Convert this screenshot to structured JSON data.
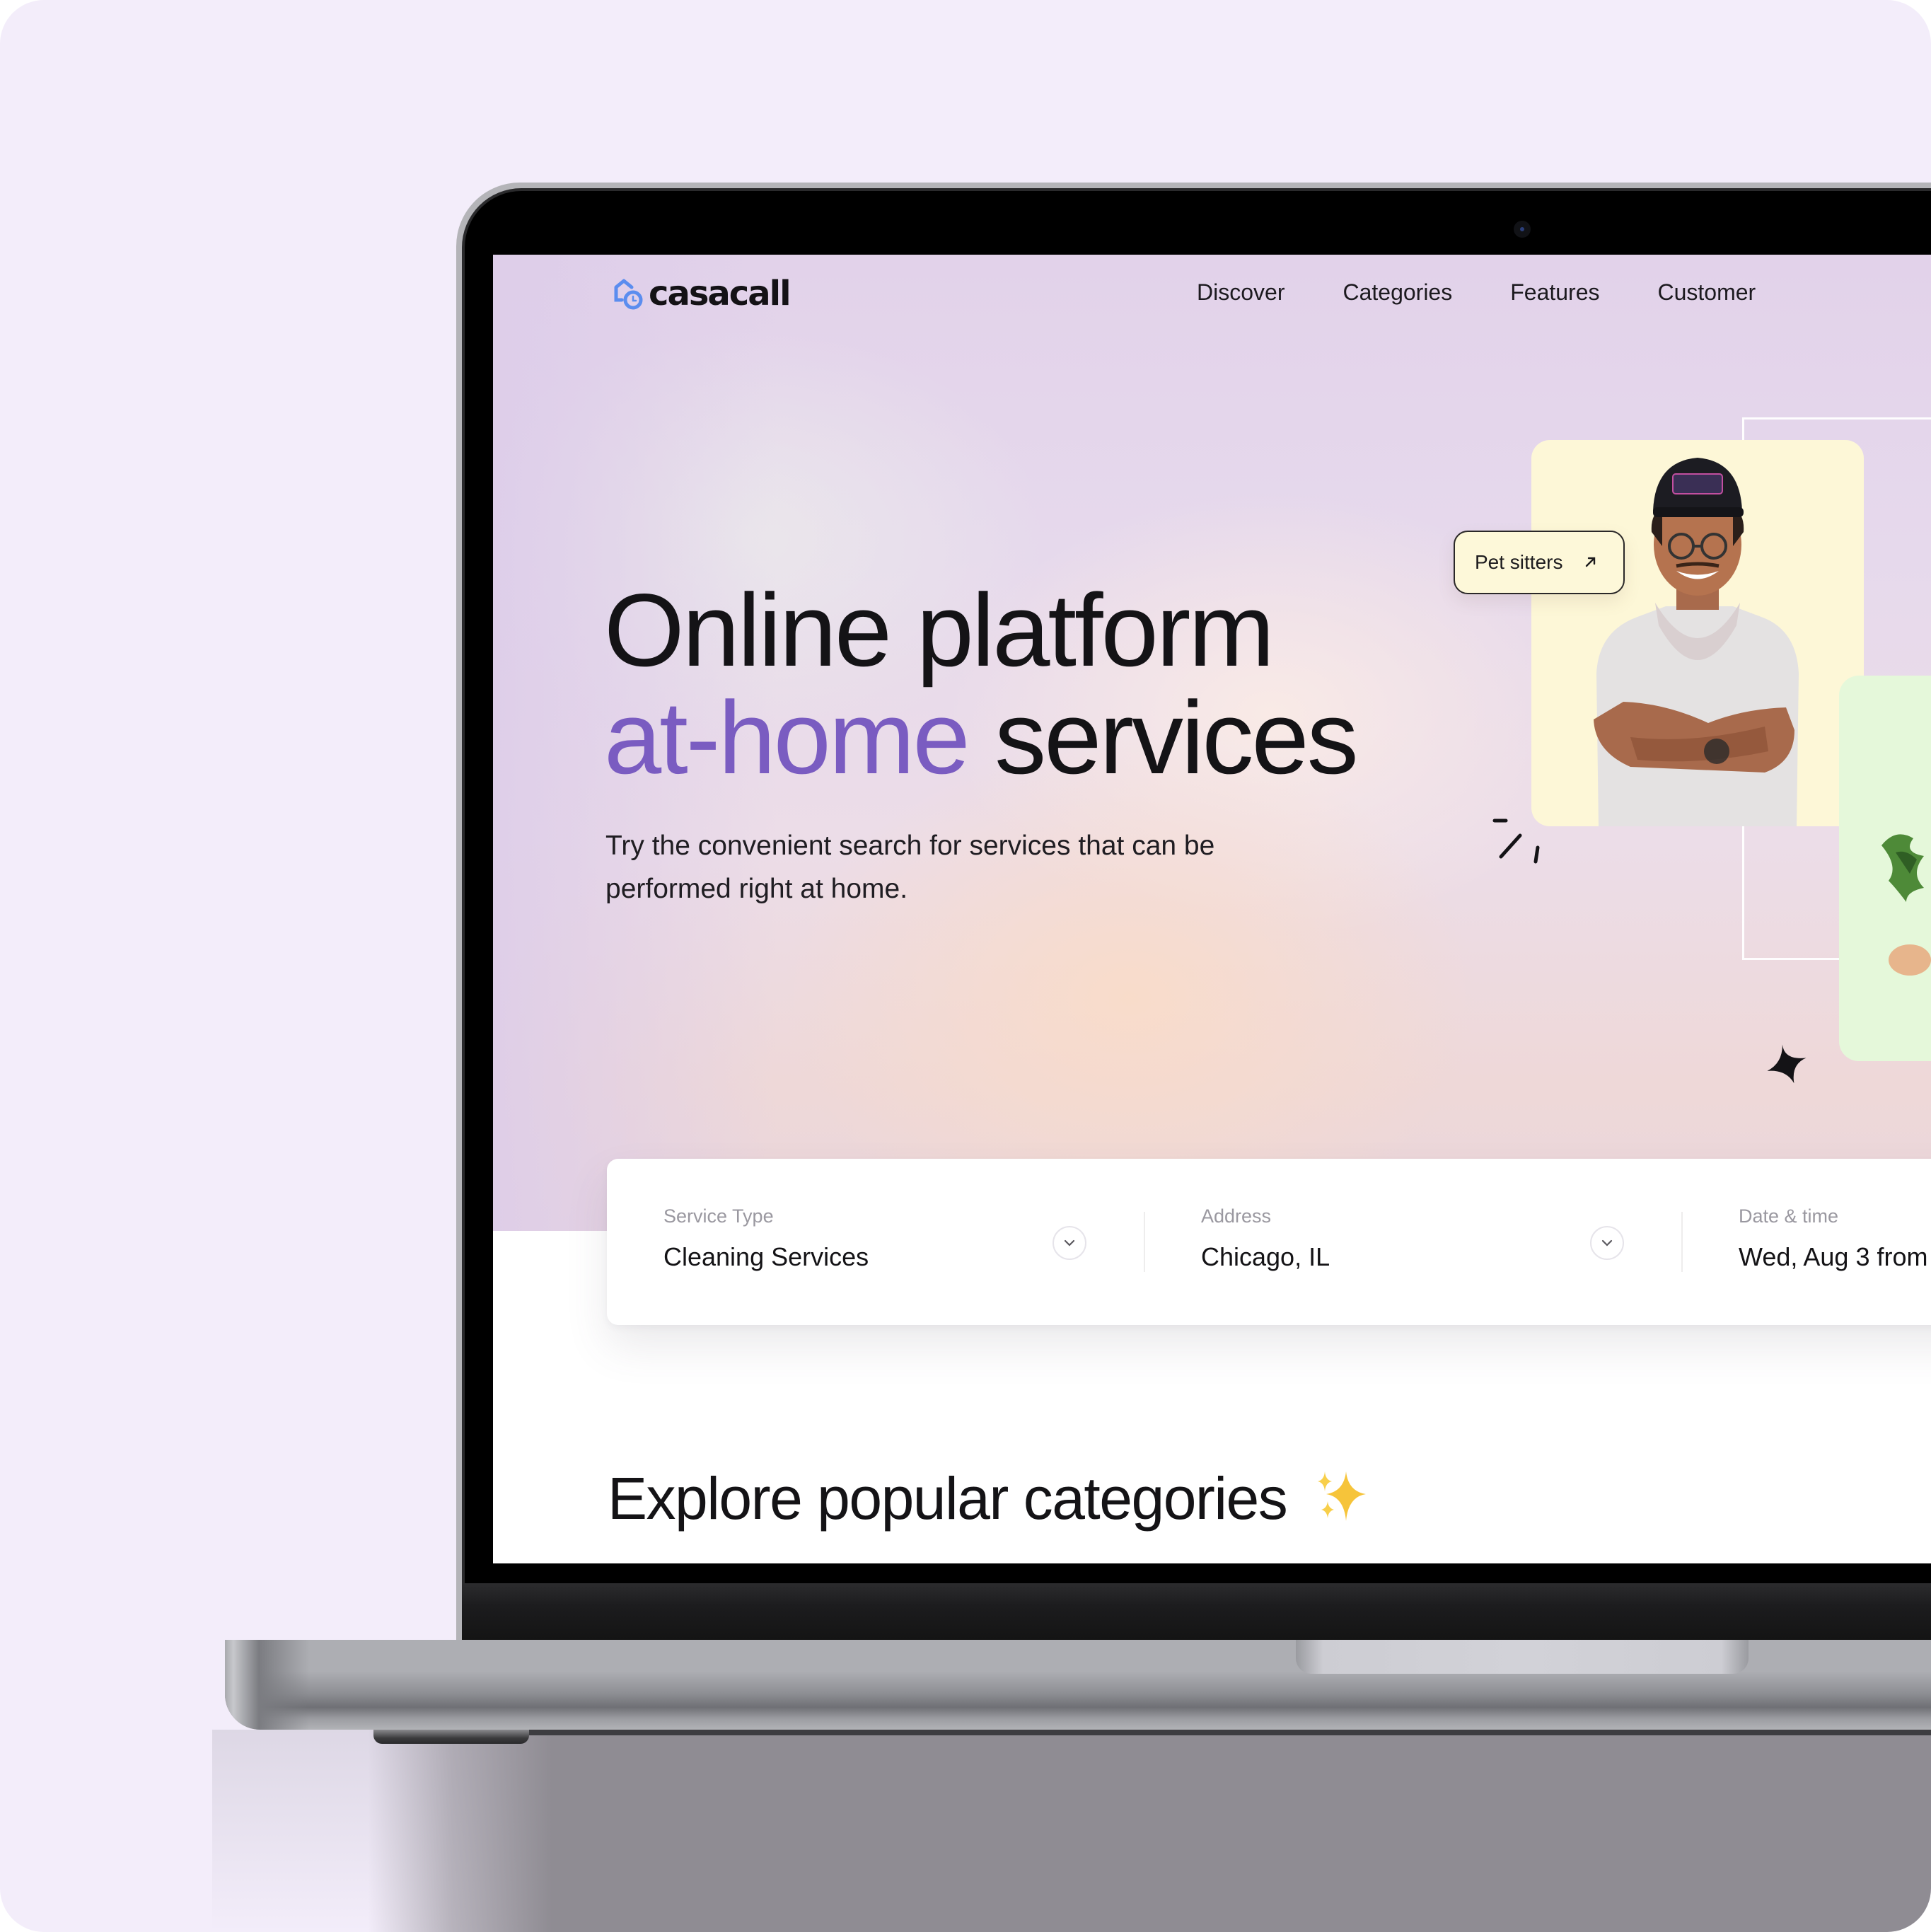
{
  "brand": {
    "name": "casacall",
    "logo_icon": "house-clock-icon",
    "logo_color": "#5b8def"
  },
  "nav": {
    "items": [
      {
        "label": "Discover"
      },
      {
        "label": "Categories"
      },
      {
        "label": "Features"
      },
      {
        "label": "Customer"
      }
    ]
  },
  "hero": {
    "headline_line1": "Online platform",
    "headline_accent": "at-home",
    "headline_rest": " services",
    "accent_color": "#7a5cc1",
    "subtitle": "Try the convenient search for services that can be performed right at home.",
    "tag_button": {
      "label": "Pet sitters",
      "icon": "arrow-up-right-icon"
    },
    "cards": [
      {
        "name": "provider-photo-card",
        "background": "#fdf7d7",
        "image": "smiling man in cap with crossed arms"
      },
      {
        "name": "plant-card",
        "background": "#e5f8da",
        "image": "potted plant"
      }
    ]
  },
  "search": {
    "fields": [
      {
        "label": "Service Type",
        "value": "Cleaning Services",
        "icon": "chevron-down-icon"
      },
      {
        "label": "Address",
        "value": "Chicago, IL",
        "icon": "chevron-down-icon"
      },
      {
        "label": "Date & time",
        "value": "Wed, Aug 3 from"
      }
    ]
  },
  "categories": {
    "heading": "Explore popular categories",
    "heading_icon": "sparkles-icon"
  },
  "colors": {
    "page_background": "#f3edfa",
    "text_primary": "#141316",
    "label_gray": "#9a98a0"
  }
}
